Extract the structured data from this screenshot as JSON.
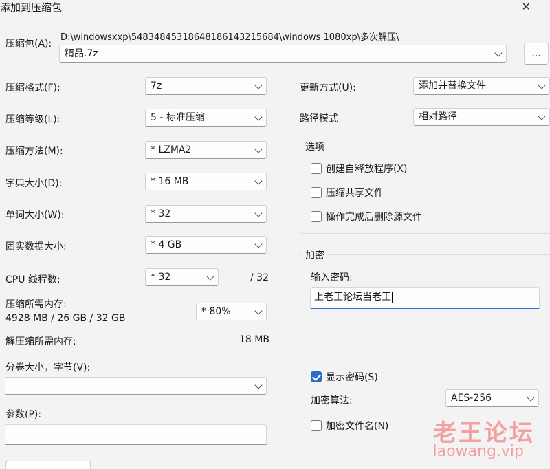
{
  "window": {
    "title": "添加到压缩包",
    "close_glyph": "✕"
  },
  "archive": {
    "label": "压缩包(A):",
    "path": "D:\\windowsxxp\\54834845318648186143215684\\windows 1080xp\\多次解压\\",
    "name": "精品.7z",
    "browse_label": "..."
  },
  "left": {
    "format": {
      "label": "压缩格式(F):",
      "value": "7z"
    },
    "level": {
      "label": "压缩等级(L):",
      "value": "5 - 标准压缩"
    },
    "method": {
      "label": "压缩方法(M):",
      "value": "* LZMA2"
    },
    "dict": {
      "label": "字典大小(D):",
      "value": "* 16 MB"
    },
    "word": {
      "label": "单词大小(W):",
      "value": "* 32"
    },
    "solid": {
      "label": "固实数据大小:",
      "value": "* 4 GB"
    },
    "cpu": {
      "label": "CPU 线程数:",
      "value": "* 32",
      "max": "/ 32"
    },
    "mem_compress": {
      "label": "压缩所需内存:",
      "detail": "4928 MB / 26 GB / 32 GB",
      "value": "* 80%"
    },
    "mem_decompress": {
      "label": "解压缩所需内存:",
      "value": "18 MB"
    },
    "volume": {
      "label": "分卷大小，字节(V):",
      "value": ""
    },
    "params": {
      "label": "参数(P):",
      "value": ""
    }
  },
  "right": {
    "update": {
      "label": "更新方式(U):",
      "value": "添加并替换文件"
    },
    "path_mode": {
      "label": "路径模式",
      "value": "相对路径"
    },
    "options": {
      "title": "选项",
      "sfx": {
        "label": "创建自释放程序(X)",
        "checked": false
      },
      "shared": {
        "label": "压缩共享文件",
        "checked": false
      },
      "delete": {
        "label": "操作完成后删除源文件",
        "checked": false
      }
    },
    "encryption": {
      "title": "加密",
      "password_label": "输入密码:",
      "password_value": "上老王论坛当老王",
      "show_password": {
        "label": "显示密码(S)",
        "checked": true
      },
      "method_label": "加密算法:",
      "method_value": "AES-256",
      "encrypt_names": {
        "label": "加密文件名(N)",
        "checked": false
      }
    }
  },
  "watermark": {
    "text": "老王论坛",
    "url": "laowang.vip"
  },
  "colors": {
    "accent": "#2a6fc9",
    "watermark": "#f4a0a0",
    "background": "#f3f3f3"
  }
}
